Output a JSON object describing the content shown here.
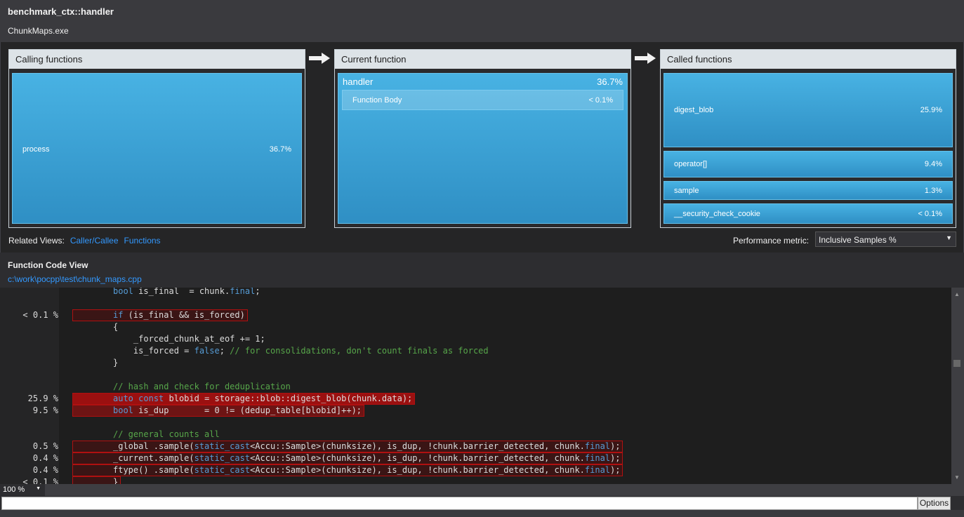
{
  "header": {
    "title": "benchmark_ctx::handler",
    "process": "ChunkMaps.exe"
  },
  "calling": {
    "title": "Calling functions",
    "items": [
      {
        "name": "process",
        "value": "36.7%"
      }
    ]
  },
  "current": {
    "title": "Current function",
    "name": "handler",
    "value": "36.7%",
    "body": {
      "name": "Function Body",
      "value": "< 0.1%"
    }
  },
  "called": {
    "title": "Called functions",
    "items": [
      {
        "name": "digest_blob",
        "value": "25.9%"
      },
      {
        "name": "operator[]",
        "value": "9.4%"
      },
      {
        "name": "sample",
        "value": "1.3%"
      },
      {
        "name": "__security_check_cookie",
        "value": "< 0.1%"
      }
    ]
  },
  "related": {
    "label": "Related Views:",
    "links": [
      "Caller/Callee",
      "Functions"
    ]
  },
  "metric": {
    "label": "Performance metric:",
    "selected": "Inclusive Samples %"
  },
  "codeview": {
    "title": "Function Code View",
    "path": "c:\\work\\pocpp\\test\\chunk_maps.cpp"
  },
  "colors": {
    "hot": "#9b1010",
    "warm": "#3a1515",
    "accent": "#3399ff"
  },
  "code": [
    {
      "pct": "",
      "heat": 0,
      "tokens": [
        [
          "bool",
          "kw"
        ],
        [
          " is_final  = chunk.",
          ""
        ],
        [
          "final",
          "kw"
        ],
        [
          ";",
          ""
        ]
      ]
    },
    {
      "pct": "",
      "heat": 0,
      "tokens": []
    },
    {
      "pct": "< 0.1 %",
      "heat": 0.1,
      "tokens": [
        [
          "if",
          "kw"
        ],
        [
          " (is_final && is_forced)",
          ""
        ]
      ]
    },
    {
      "pct": "",
      "heat": 0,
      "tokens": [
        [
          "{",
          ""
        ]
      ]
    },
    {
      "pct": "",
      "heat": 0,
      "tokens": [
        [
          "    _forced_chunk_at_eof += 1;",
          ""
        ]
      ]
    },
    {
      "pct": "",
      "heat": 0,
      "tokens": [
        [
          "    is_forced = ",
          ""
        ],
        [
          "false",
          "kw"
        ],
        [
          "; ",
          ""
        ],
        [
          "// for consolidations, don't count finals as forced",
          "cm"
        ]
      ]
    },
    {
      "pct": "",
      "heat": 0,
      "tokens": [
        [
          "}",
          ""
        ]
      ]
    },
    {
      "pct": "",
      "heat": 0,
      "tokens": []
    },
    {
      "pct": "",
      "heat": 0,
      "tokens": [
        [
          "// hash and check for deduplication",
          "cm"
        ]
      ]
    },
    {
      "pct": "25.9 %",
      "heat": 1,
      "tokens": [
        [
          "auto",
          "kw"
        ],
        [
          " ",
          ""
        ],
        [
          "const",
          "kw"
        ],
        [
          " blobid = storage::blob::digest_blob(chunk.data);",
          ""
        ]
      ]
    },
    {
      "pct": "9.5 %",
      "heat": 0.6,
      "tokens": [
        [
          "bool",
          "kw"
        ],
        [
          " is_dup       = 0 != (dedup_table[blobid]++);",
          ""
        ]
      ]
    },
    {
      "pct": "",
      "heat": 0,
      "tokens": []
    },
    {
      "pct": "",
      "heat": 0,
      "tokens": [
        [
          "// general counts all",
          "cm"
        ]
      ]
    },
    {
      "pct": "0.5 %",
      "heat": 0.15,
      "tokens": [
        [
          "_global .sample(",
          ""
        ],
        [
          "static_cast",
          "kw"
        ],
        [
          "<Accu::Sample>(chunksize), is_dup, !chunk.barrier_detected, chunk.",
          ""
        ],
        [
          "final",
          "kw"
        ],
        [
          ");",
          ""
        ]
      ]
    },
    {
      "pct": "0.4 %",
      "heat": 0.15,
      "tokens": [
        [
          "_current.sample(",
          ""
        ],
        [
          "static_cast",
          "kw"
        ],
        [
          "<Accu::Sample>(chunksize), is_dup, !chunk.barrier_detected, chunk.",
          ""
        ],
        [
          "final",
          "kw"
        ],
        [
          ");",
          ""
        ]
      ]
    },
    {
      "pct": "0.4 %",
      "heat": 0.15,
      "tokens": [
        [
          "ftype() .sample(",
          ""
        ],
        [
          "static_cast",
          "kw"
        ],
        [
          "<Accu::Sample>(chunksize), is_dup, !chunk.barrier_detected, chunk.",
          ""
        ],
        [
          "final",
          "kw"
        ],
        [
          ");",
          ""
        ]
      ]
    },
    {
      "pct": "< 0.1 %",
      "heat": 0.1,
      "tokens": [
        [
          "}",
          ""
        ]
      ]
    }
  ],
  "footer": {
    "zoom": "100 %",
    "options": "Options"
  }
}
